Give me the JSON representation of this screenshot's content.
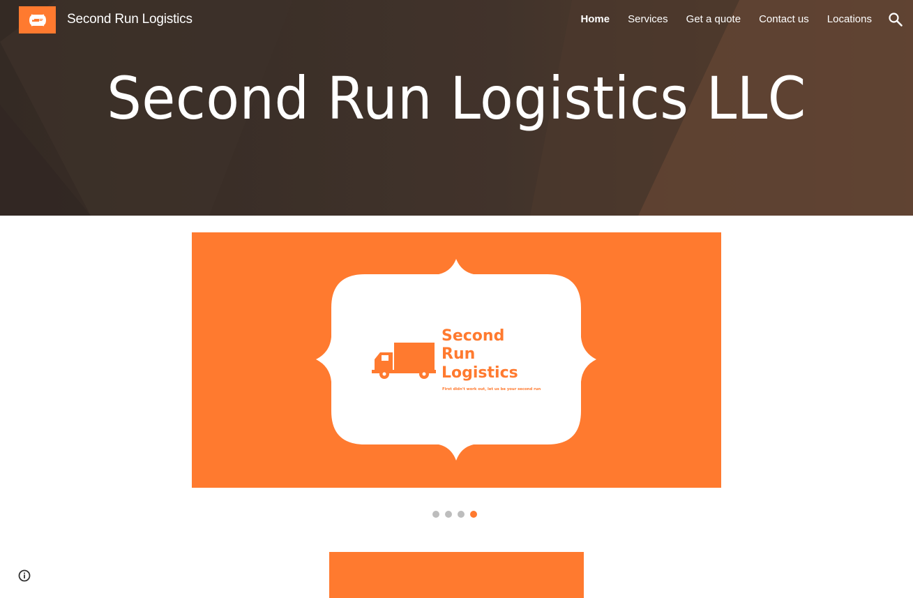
{
  "header": {
    "site_title": "Second Run Logistics",
    "logo_icon": "truck-logo-icon",
    "nav": [
      {
        "label": "Home",
        "active": true
      },
      {
        "label": "Services",
        "active": false
      },
      {
        "label": "Get a quote",
        "active": false
      },
      {
        "label": "Contact us",
        "active": false
      },
      {
        "label": "Locations",
        "active": false
      }
    ],
    "search_icon": "search-icon"
  },
  "hero": {
    "title": "Second Run Logistics LLC"
  },
  "carousel": {
    "slide_logo_text": [
      "Second",
      "Run",
      "Logistics"
    ],
    "slide_tagline": "First didn't work out, let us be your second run",
    "active_index": 3,
    "total": 4
  },
  "footer": {
    "info_icon": "info-icon"
  },
  "colors": {
    "accent": "#ff7a2f",
    "hero_bg": "#4a3a30",
    "dot_inactive": "#bdbdbd"
  }
}
